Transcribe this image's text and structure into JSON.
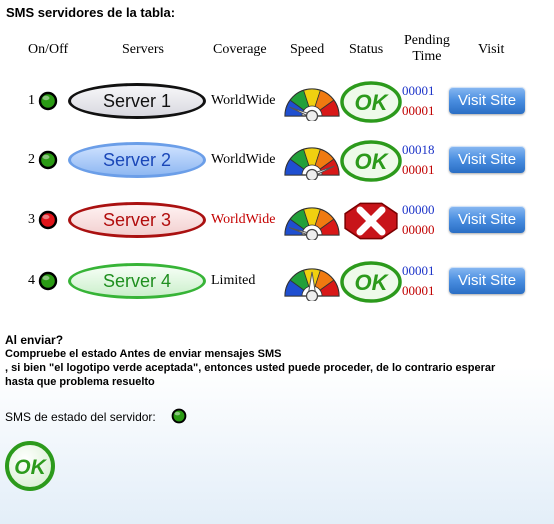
{
  "title": "SMS servidores de la tabla:",
  "headers": {
    "onoff": "On/Off",
    "servers": "Servers",
    "coverage": "Coverage",
    "speed": "Speed",
    "status": "Status",
    "pending_line1": "Pending",
    "pending_line2": "Time",
    "visit": "Visit"
  },
  "rows": [
    {
      "num": "1",
      "led_color": "#2a9a14",
      "server": "Server 1",
      "coverage": "WorldWide",
      "speed_level": 0.12,
      "status": "ok",
      "status_label": "OK",
      "pending_a": "00001",
      "pending_b": "00001",
      "visit_label": "Visit Site"
    },
    {
      "num": "2",
      "led_color": "#2a9a14",
      "server": "Server 2",
      "coverage": "WorldWide",
      "speed_level": 0.88,
      "status": "ok",
      "status_label": "OK",
      "pending_a": "00018",
      "pending_b": "00001",
      "visit_label": "Visit Site"
    },
    {
      "num": "3",
      "led_color": "#e0141a",
      "server": "Server 3",
      "coverage": "WorldWide",
      "speed_level": 0.1,
      "status": "error",
      "status_label": "",
      "pending_a": "00000",
      "pending_b": "00000",
      "visit_label": "Visit Site"
    },
    {
      "num": "4",
      "led_color": "#2a9a14",
      "server": "Server 4",
      "coverage": "Limited",
      "speed_level": 0.5,
      "status": "ok",
      "status_label": "OK",
      "pending_a": "00001",
      "pending_b": "00001",
      "visit_label": "Visit Site"
    }
  ],
  "note": {
    "heading": "Al enviar?",
    "line1": "Compruebe el estado Antes de enviar mensajes SMS",
    "line2": ", si bien \"el logotipo verde aceptada\", entonces usted puede proceder, de lo contrario esperar",
    "line3": "hasta que problema resuelto"
  },
  "legend": {
    "label": "SMS de estado del servidor:",
    "led_color": "#2a9a14"
  },
  "bottom_ok_label": "OK",
  "colors": {
    "gauge": [
      "#1f4fd0",
      "#22a03a",
      "#f0d010",
      "#f07a10",
      "#d81818"
    ],
    "ok_green": "#2c9a1c",
    "error_red": "#c8141a"
  }
}
